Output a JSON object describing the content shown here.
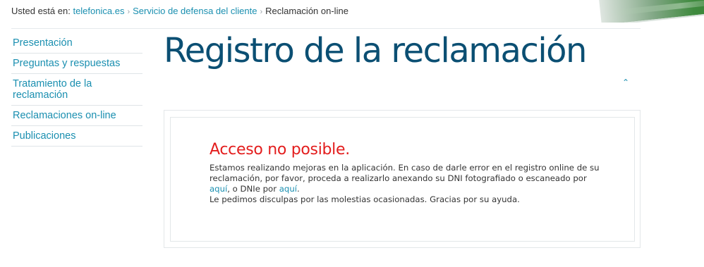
{
  "breadcrumb": {
    "prefix": "Usted está en:",
    "items": [
      "telefonica.es",
      "Servicio de defensa del cliente"
    ],
    "current": "Reclamación on-line",
    "separator": "›"
  },
  "sidebar": {
    "items": [
      {
        "label": "Presentación"
      },
      {
        "label": "Preguntas y respuestas"
      },
      {
        "label": "Tratamiento de la reclamación"
      },
      {
        "label": "Reclamaciones on-line"
      },
      {
        "label": "Publicaciones"
      }
    ]
  },
  "page": {
    "title": "Registro de la reclamación",
    "caret": "⌃"
  },
  "notice": {
    "heading": "Acceso no posible.",
    "line1_a": "Estamos realizando mejoras en la aplicación. En caso de darle error en el registro online de su reclamación, por favor, proceda a realizarlo anexando su DNI fotografiado o escaneado por ",
    "link1": "aquí",
    "line1_b": ", o DNIe por ",
    "link2": "aquí",
    "line1_c": ".",
    "line2": "Le pedimos disculpas por las molestias ocasionadas. Gracias por su ayuda."
  },
  "colors": {
    "link": "#1a8fb0",
    "title": "#0b4f73",
    "error": "#e31d1d"
  }
}
